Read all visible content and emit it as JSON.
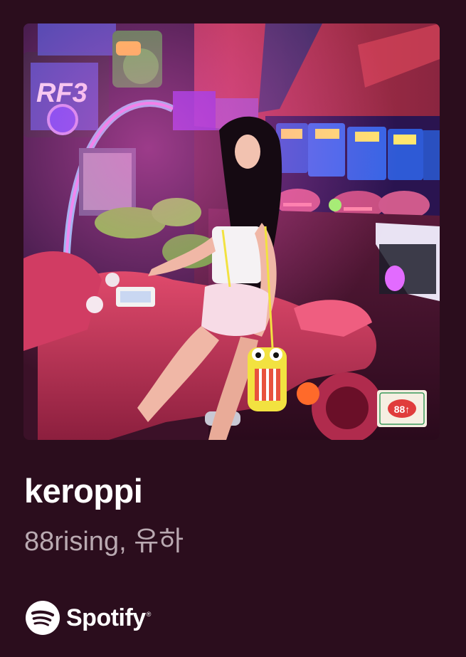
{
  "share_card": {
    "title": "keroppi",
    "artists": "88rising, 유하",
    "brand": {
      "name": "Spotify",
      "icon": "spotify-logo-icon",
      "registered_mark": "®"
    },
    "colors": {
      "background": "#2b0d1d",
      "title": "#ffffff",
      "artists": "#b9a9b1",
      "brand": "#ffffff"
    }
  },
  "cover_art": {
    "description_icon": "album-cover-image",
    "sticker_text": "88↑"
  }
}
